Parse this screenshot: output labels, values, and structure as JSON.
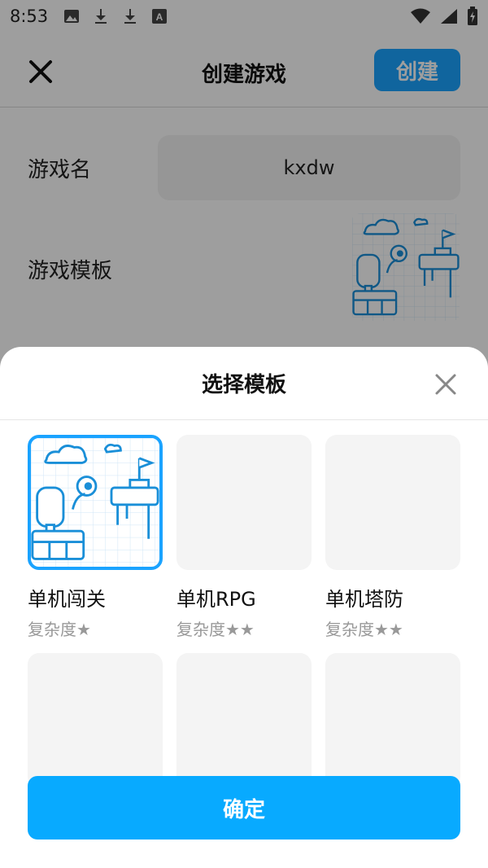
{
  "status_bar": {
    "time": "8:53",
    "icons_left": [
      "image-icon",
      "download-icon",
      "download-icon",
      "text-a-icon"
    ],
    "icons_right": [
      "wifi-icon",
      "signal-icon",
      "battery-icon"
    ]
  },
  "header": {
    "title": "创建游戏",
    "create_label": "创建"
  },
  "form": {
    "name_label": "游戏名",
    "name_value": "kxdw",
    "template_label": "游戏模板"
  },
  "sheet": {
    "title": "选择模板",
    "confirm_label": "确定",
    "templates": [
      {
        "name": "单机闯关",
        "complexity": "复杂度★",
        "selected": true
      },
      {
        "name": "单机RPG",
        "complexity": "复杂度★★",
        "selected": false
      },
      {
        "name": "单机塔防",
        "complexity": "复杂度★★",
        "selected": false
      },
      {
        "name": "",
        "complexity": "",
        "selected": false
      },
      {
        "name": "",
        "complexity": "",
        "selected": false
      },
      {
        "name": "",
        "complexity": "",
        "selected": false
      }
    ]
  },
  "colors": {
    "accent": "#1aa3ff",
    "confirm": "#08aaff",
    "muted_text": "#999999"
  }
}
